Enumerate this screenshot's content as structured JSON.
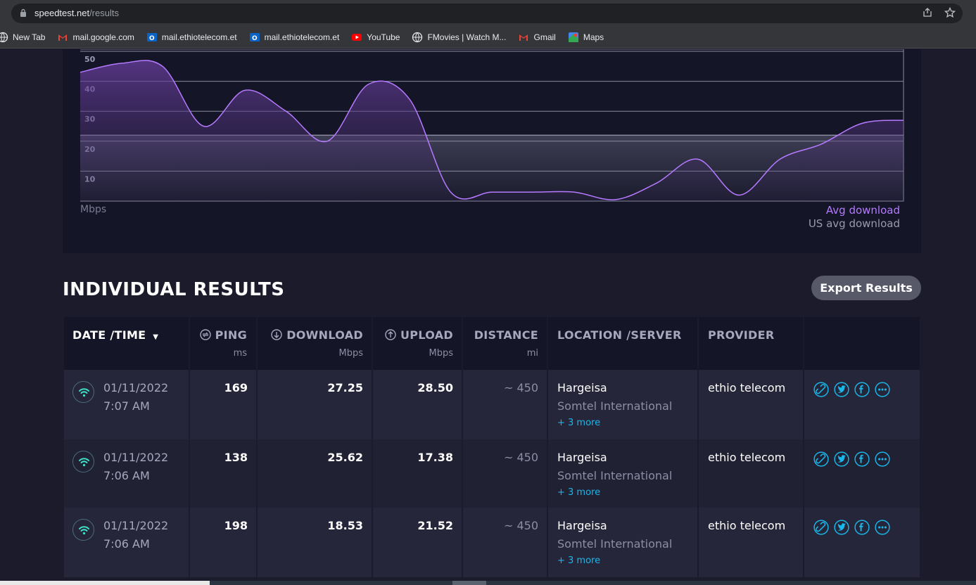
{
  "browser": {
    "url_host": "speedtest.net",
    "url_path": "/results",
    "bookmarks": [
      {
        "label": "New Tab",
        "icon": "globe-icon",
        "color": "#e8eaed"
      },
      {
        "label": "mail.google.com",
        "icon": "gmail-icon",
        "color": "#ea4335"
      },
      {
        "label": "mail.ethiotelecom.et",
        "icon": "outlook-icon",
        "color": "#0a64c8"
      },
      {
        "label": "mail.ethiotelecom.et",
        "icon": "outlook-icon",
        "color": "#0a64c8"
      },
      {
        "label": "YouTube",
        "icon": "youtube-icon",
        "color": "#ff0000"
      },
      {
        "label": "FMovies | Watch M...",
        "icon": "globe-icon",
        "color": "#e8eaed"
      },
      {
        "label": "Gmail",
        "icon": "gmail-icon",
        "color": "#ea4335"
      },
      {
        "label": "Maps",
        "icon": "maps-icon",
        "color": "#34a853"
      }
    ]
  },
  "chart": {
    "y_ticks": [
      "50",
      "40",
      "30",
      "20",
      "10"
    ],
    "unit_label": "Mbps",
    "legend_avg": "Avg download",
    "legend_us": "US avg download",
    "avg_color": "#b57aff",
    "us_color": "#9a9aae"
  },
  "chart_data": {
    "type": "area",
    "ylabel": "Mbps",
    "ylim": [
      0,
      50
    ],
    "series": [
      {
        "name": "Avg download",
        "values": [
          43,
          46,
          45,
          25,
          37,
          30,
          20,
          39,
          34,
          3,
          3,
          3,
          3,
          0.5,
          6,
          14,
          2,
          14,
          19,
          26,
          27
        ]
      },
      {
        "name": "US avg download",
        "values": [
          22,
          22,
          22,
          22,
          22,
          22,
          22,
          22,
          22,
          22,
          22,
          22,
          22,
          22,
          22,
          22,
          22,
          22,
          22,
          22,
          22
        ]
      }
    ]
  },
  "results": {
    "title": "INDIVIDUAL RESULTS",
    "export_label": "Export Results",
    "headers": {
      "date": "DATE /TIME",
      "ping": "PING",
      "ping_unit": "ms",
      "download": "DOWNLOAD",
      "download_unit": "Mbps",
      "upload": "UPLOAD",
      "upload_unit": "Mbps",
      "distance": "DISTANCE",
      "distance_unit": "mi",
      "location": "LOCATION /SERVER",
      "provider": "PROVIDER"
    },
    "rows": [
      {
        "date": "01/11/2022",
        "time": "7:07 AM",
        "ping": "169",
        "download": "27.25",
        "upload": "28.50",
        "distance": "~ 450",
        "location": "Hargeisa",
        "server": "Somtel International",
        "more": "+ 3 more",
        "provider": "ethio telecom"
      },
      {
        "date": "01/11/2022",
        "time": "7:06 AM",
        "ping": "138",
        "download": "25.62",
        "upload": "17.38",
        "distance": "~ 450",
        "location": "Hargeisa",
        "server": "Somtel International",
        "more": "+ 3 more",
        "provider": "ethio telecom"
      },
      {
        "date": "01/11/2022",
        "time": "7:06 AM",
        "ping": "198",
        "download": "18.53",
        "upload": "21.52",
        "distance": "~ 450",
        "location": "Hargeisa",
        "server": "Somtel International",
        "more": "+ 3 more",
        "provider": "ethio telecom"
      }
    ]
  }
}
